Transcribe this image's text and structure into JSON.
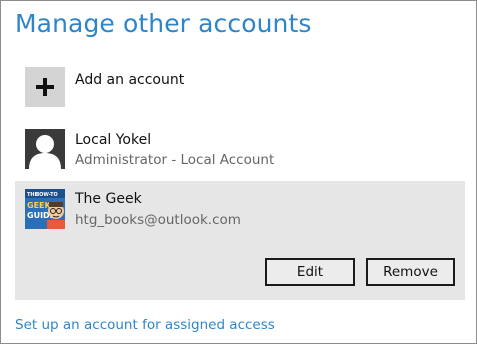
{
  "page": {
    "title": "Manage other accounts"
  },
  "accounts": {
    "add": {
      "label": "Add an account"
    },
    "local": {
      "name": "Local Yokel",
      "detail": "Administrator - Local Account"
    },
    "geek": {
      "name": "The Geek",
      "email": "htg_books@outlook.com",
      "avatar_text": [
        "THE",
        "HOW-TO",
        "GEEK",
        "GUIDE"
      ],
      "edit_label": "Edit",
      "remove_label": "Remove"
    }
  },
  "footer": {
    "assigned_access_link": "Set up an account for assigned access"
  },
  "colors": {
    "accent": "#2e86c8",
    "selected_row": "#e6e6e6",
    "secondary_text": "#666666"
  }
}
